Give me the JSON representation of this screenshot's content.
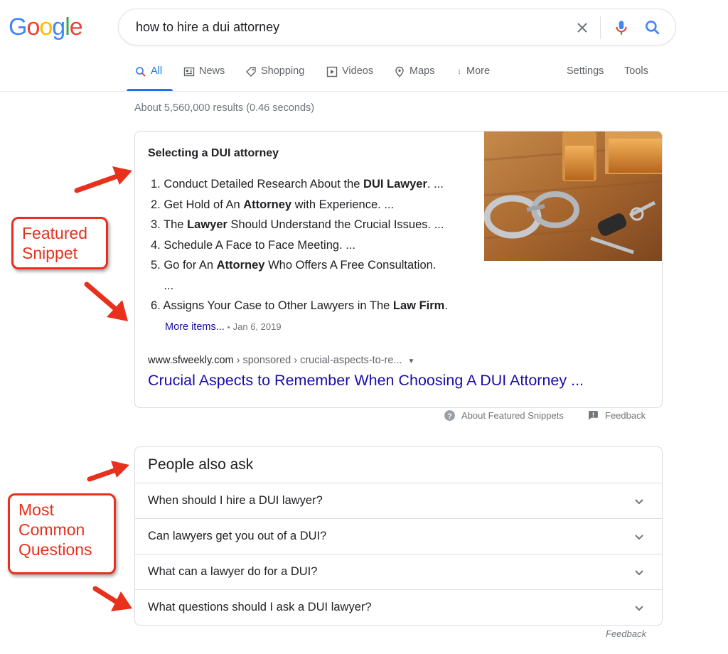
{
  "logo": {
    "letters": [
      "G",
      "o",
      "o",
      "g",
      "l",
      "e"
    ],
    "colors": [
      "#4285f4",
      "#ea4335",
      "#fbbc05",
      "#4285f4",
      "#34a853",
      "#ea4335"
    ]
  },
  "search": {
    "query": "how to hire a dui attorney"
  },
  "tabs": [
    {
      "label": "All",
      "icon": "search-icon"
    },
    {
      "label": "News",
      "icon": "news-icon"
    },
    {
      "label": "Shopping",
      "icon": "tag-icon"
    },
    {
      "label": "Videos",
      "icon": "play-icon"
    },
    {
      "label": "Maps",
      "icon": "pin-icon"
    },
    {
      "label": "More",
      "icon": "dots-vertical-icon"
    }
  ],
  "tools": {
    "settings": "Settings",
    "tools": "Tools"
  },
  "stats": "About 5,560,000 results (0.46 seconds)",
  "snippet": {
    "title": "Selecting a DUI attorney",
    "items": [
      "1. Conduct Detailed Research About the <b>DUI Lawyer</b>. ...",
      "2. Get Hold of An <b>Attorney</b> with Experience. ...",
      "3. The <b>Lawyer</b> Should Understand the Crucial Issues. ...",
      "4. Schedule A Face to Face Meeting. ...",
      "5. Go for An <b>Attorney</b> Who Offers A Free Consultation.<br>&nbsp;&nbsp;&nbsp;&nbsp;...",
      "6. Assigns Your Case to Other Lawyers in The <b>Law Firm</b>."
    ],
    "more_items": "More items...",
    "date": "Jan 6, 2019",
    "cite_domain": "www.sfweekly.com",
    "cite_path": " › sponsored › crucial-aspects-to-re...",
    "link_title": "Crucial Aspects to Remember When Choosing A DUI Attorney ..."
  },
  "snippet_footer": {
    "about": "About Featured Snippets",
    "feedback": "Feedback"
  },
  "paa": {
    "title": "People also ask",
    "questions": [
      "When should I hire a DUI lawyer?",
      "Can lawyers get you out of a DUI?",
      "What can a lawyer do for a DUI?",
      "What questions should I ask a DUI lawyer?"
    ],
    "feedback": "Feedback"
  },
  "annotations": {
    "featured": [
      "Featured",
      "Snippet"
    ],
    "common": [
      "Most",
      "Common",
      "Questions"
    ],
    "color": "#e8301c"
  },
  "colors": {
    "link": "#1a0dab",
    "accent": "#1a73e8",
    "muted": "#70757a"
  }
}
